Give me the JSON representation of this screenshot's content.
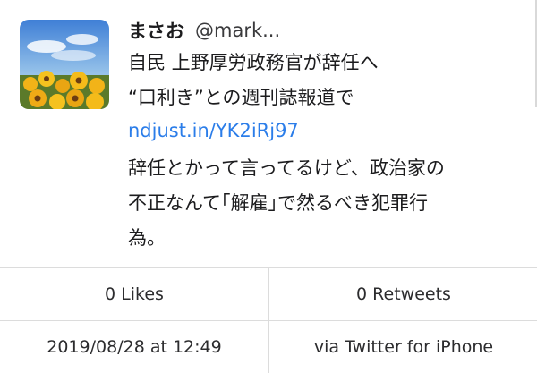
{
  "tweet": {
    "display_name": "まさお",
    "handle": "@mark...",
    "body_lines": [
      "自民 上野厚労政務官が辞任へ",
      "“口利き”との週刊誌報道で"
    ],
    "link": "ndjust.in/YK2iRj97",
    "body_lines_after": [
      "辞任とかって言ってるけど、政治家の",
      "不正なんて｢解雇｣で然るべき犯罪行",
      "為。"
    ]
  },
  "stats": {
    "likes": "0 Likes",
    "retweets": "0 Retweets"
  },
  "meta": {
    "timestamp": "2019/08/28 at 12:49",
    "source": "via Twitter for iPhone"
  },
  "colors": {
    "link": "#2b7de9",
    "divider": "#dcdcdc"
  }
}
